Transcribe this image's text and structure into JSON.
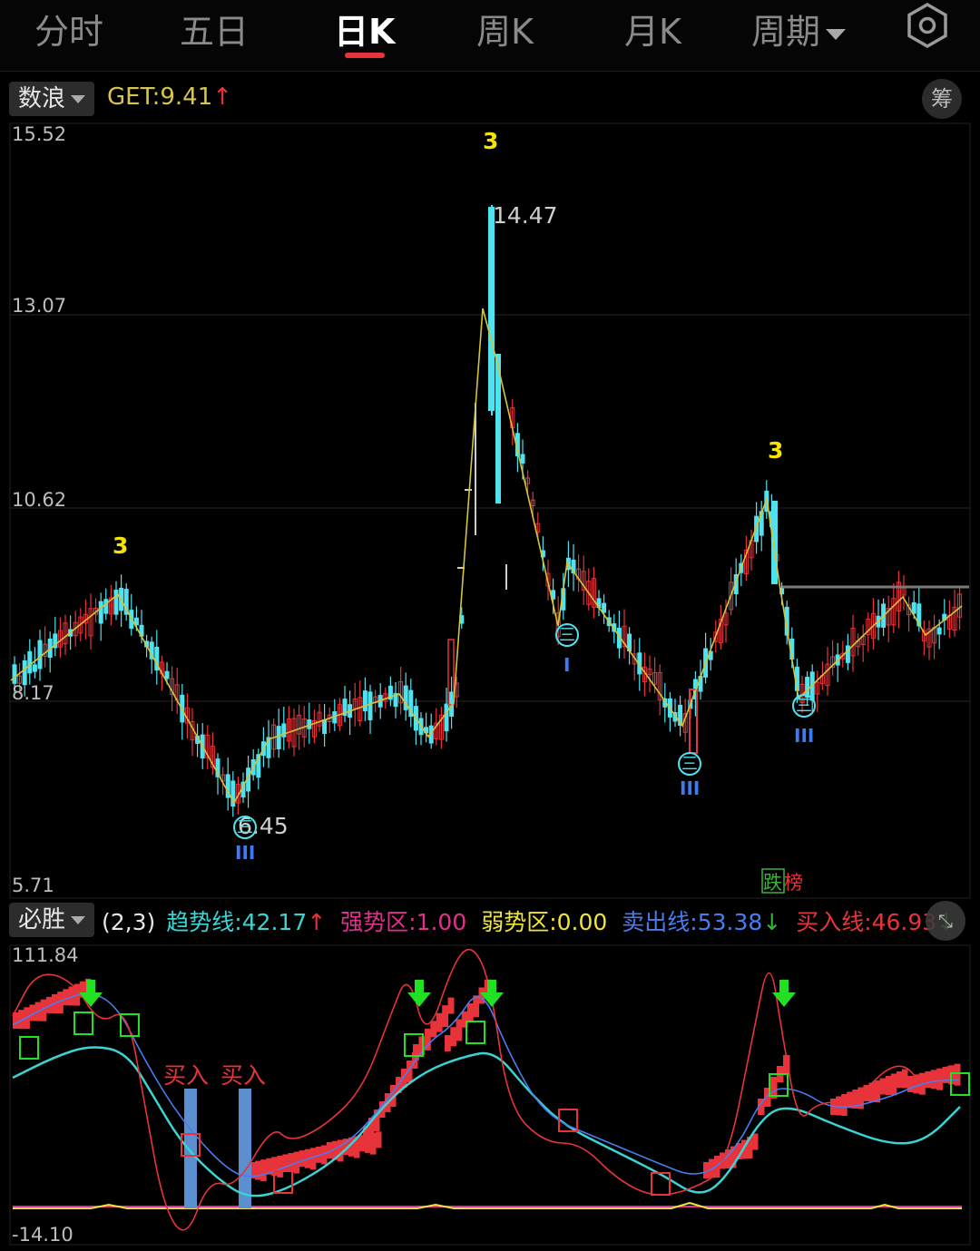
{
  "tabs": [
    {
      "label": "分时"
    },
    {
      "label": "五日"
    },
    {
      "label": "日K"
    },
    {
      "label": "周K"
    },
    {
      "label": "月K"
    },
    {
      "label": "周期"
    }
  ],
  "active_tab": "日K",
  "main_indicator": {
    "name": "数浪",
    "get_label": "GET:",
    "get_value": "9.41",
    "get_arrow": "↑",
    "chip_button": "筹"
  },
  "price_axis": {
    "labels": [
      "15.52",
      "13.07",
      "10.62",
      "8.17",
      "5.71"
    ]
  },
  "annotations": {
    "wave_top_labels": [
      "3",
      "3",
      "3"
    ],
    "high_label": "14.47",
    "low_label": "6.45",
    "wave_circles": [
      "三",
      "三",
      "三",
      "三"
    ],
    "wave_counts": [
      "III",
      "I",
      "III",
      "III"
    ],
    "corner_tag": {
      "left": "跌",
      "right": "榜"
    }
  },
  "sub_indicator": {
    "name": "必胜",
    "params": "(2,3)",
    "items": [
      {
        "label": "趋势线:",
        "value": "42.17",
        "arrow": "↑",
        "color": "#3ad4d4"
      },
      {
        "label": "强势区:",
        "value": "1.00",
        "arrow": "",
        "color": "#e0308c"
      },
      {
        "label": "弱势区:",
        "value": "0.00",
        "arrow": "",
        "color": "#f0e43c"
      },
      {
        "label": "卖出线:",
        "value": "53.38",
        "arrow": "↓",
        "color": "#4a7cf0"
      },
      {
        "label": "买入线:",
        "value": "46.93",
        "arrow": "↓",
        "color": "#e8333a"
      }
    ],
    "axis_top": "111.84",
    "axis_bottom": "-14.10",
    "buy_labels": [
      "买入",
      "买入"
    ]
  },
  "colors": {
    "up": "#e8333a",
    "down": "#4fe3f0",
    "wave_line": "#d6c33a",
    "label_yellow": "#f5e400",
    "background": "#000000",
    "grid": "#1e1e1e"
  },
  "icons": {
    "settings": "settings-hexagon-icon",
    "expand": "expand-arrows-icon"
  }
}
